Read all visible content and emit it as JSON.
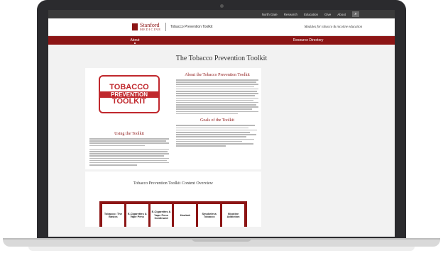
{
  "topnav": {
    "items": [
      "North Gate",
      "Research",
      "Education",
      "Give",
      "About"
    ],
    "search_icon": "search-icon"
  },
  "brand": {
    "stanford": "Stanford",
    "medicine": "MEDICINE",
    "toolkit": "Tobacco Prevention Toolkit",
    "tagline": "Modules for tobacco & nicotine education"
  },
  "mainnav": {
    "tabs": [
      "About",
      "Resource Directory"
    ]
  },
  "page": {
    "title": "The Tobacco Prevention Toolkit"
  },
  "logo_art": {
    "line1": "TOBACCO",
    "line2": "PREVENTION",
    "line3": "TOOLKIT"
  },
  "about": {
    "heading": "About the Tobacco Prevention Toolkit"
  },
  "using": {
    "heading": "Using the Toolkit"
  },
  "goals": {
    "heading": "Goals of the Toolkit"
  },
  "overview": {
    "title": "Tobacco Prevention Toolkit Content Overview",
    "cards": [
      "Tobacco: The Basics",
      "E-Cigarettes & Vape Pens",
      "E-Cigarettes & Vape Pens Continued",
      "Hookah",
      "Smokeless Tobacco",
      "Nicotine Addiction"
    ]
  },
  "colors": {
    "brand": "#8c1515",
    "logo_red": "#c0282d",
    "topnav_bg": "#3a3a3a"
  }
}
